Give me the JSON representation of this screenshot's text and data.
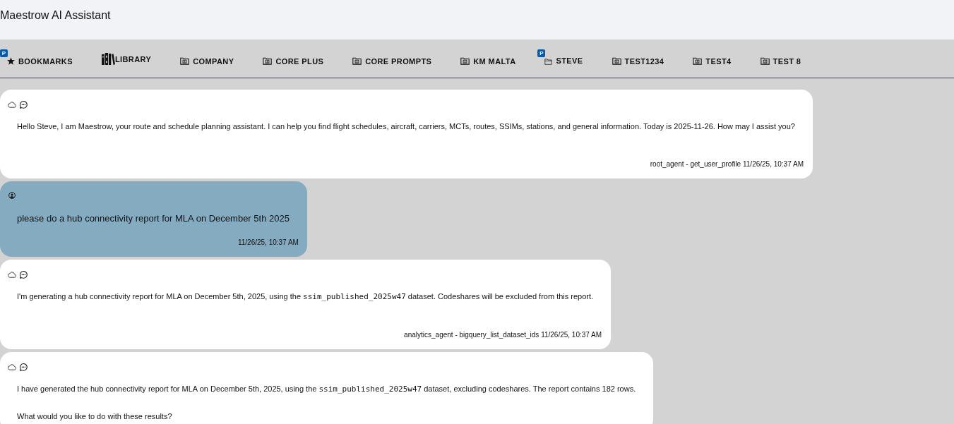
{
  "header": {
    "title": "Maestrow AI Assistant"
  },
  "tabs": [
    {
      "label": "BOOKMARKS",
      "kind": "star",
      "badge": "P"
    },
    {
      "label": "LIBRARY",
      "kind": "books"
    },
    {
      "label": "COMPANY",
      "kind": "shared-folder"
    },
    {
      "label": "CORE PLUS",
      "kind": "shared-folder"
    },
    {
      "label": "CORE PROMPTS",
      "kind": "shared-folder"
    },
    {
      "label": "KM MALTA",
      "kind": "shared-folder"
    },
    {
      "label": "STEVE",
      "kind": "folder",
      "badge": "P"
    },
    {
      "label": "TEST1234",
      "kind": "shared-folder"
    },
    {
      "label": "TEST4",
      "kind": "shared-folder"
    },
    {
      "label": "TEST 8",
      "kind": "shared-folder"
    }
  ],
  "messages": [
    {
      "kind": "agent",
      "paragraphs": [
        [
          {
            "kind": "text",
            "text": "Hello Steve, I am Maestrow, your route and schedule planning assistant. I can help you find flight schedules, aircraft, carriers, MCTs, routes, SSIMs, stations, and general information. Today is 2025-11-26. How may I assist you?"
          }
        ]
      ],
      "source": "root_agent - get_user_profile",
      "time": "11/26/25, 10:37 AM"
    },
    {
      "kind": "user",
      "paragraphs": [
        [
          {
            "kind": "text",
            "text": "please do a hub connectivity report for MLA on December 5th 2025"
          }
        ]
      ],
      "time": "11/26/25, 10:37 AM"
    },
    {
      "kind": "agent",
      "paragraphs": [
        [
          {
            "kind": "text",
            "text": "I'm generating a hub connectivity report for MLA on December 5th, 2025, using the "
          },
          {
            "kind": "code",
            "text": "ssim_published_2025w47"
          },
          {
            "kind": "text",
            "text": " dataset. Codeshares will be excluded from this report."
          }
        ]
      ],
      "source": "analytics_agent - bigquery_list_dataset_ids",
      "time": "11/26/25, 10:37 AM"
    },
    {
      "kind": "agent",
      "paragraphs": [
        [
          {
            "kind": "text",
            "text": "I have generated the hub connectivity report for MLA on December 5th, 2025, using the "
          },
          {
            "kind": "code",
            "text": "ssim_published_2025w47"
          },
          {
            "kind": "text",
            "text": " dataset, excluding codeshares. The report contains 182 rows."
          }
        ],
        [
          {
            "kind": "text",
            "text": "What would you like to do with these results?"
          }
        ]
      ]
    }
  ]
}
